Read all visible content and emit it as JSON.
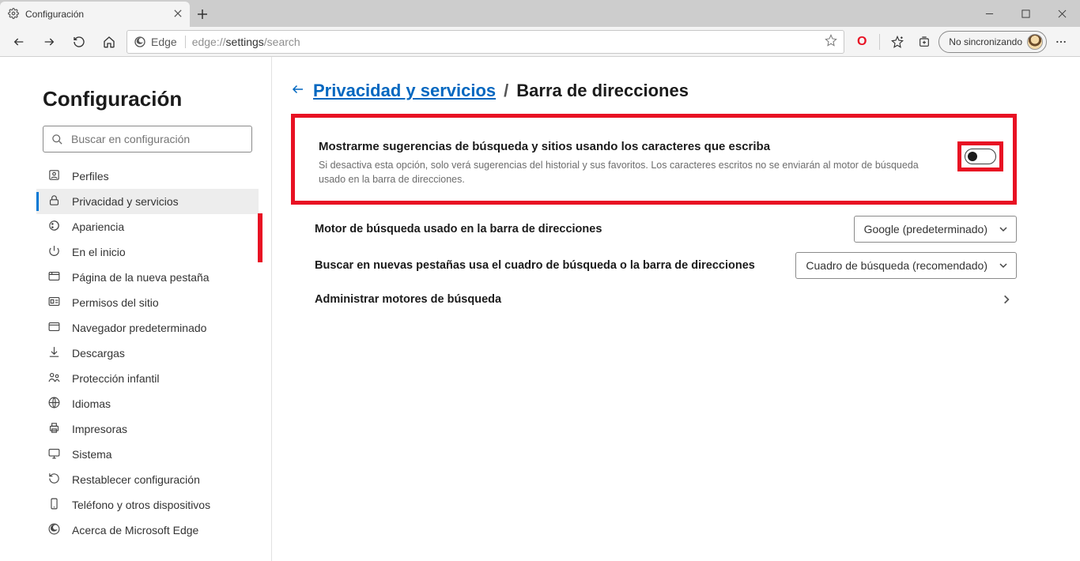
{
  "window": {
    "tab_title": "Configuración",
    "sync_label": "No sincronizando"
  },
  "address": {
    "edge_label": "Edge",
    "url_prefix": "edge://",
    "url_bold": "settings",
    "url_suffix": "/search"
  },
  "sidebar": {
    "title": "Configuración",
    "search_placeholder": "Buscar en configuración",
    "items": [
      {
        "label": "Perfiles",
        "icon": "profile"
      },
      {
        "label": "Privacidad y servicios",
        "icon": "lock",
        "active": true
      },
      {
        "label": "Apariencia",
        "icon": "appearance"
      },
      {
        "label": "En el inicio",
        "icon": "power"
      },
      {
        "label": "Página de la nueva pestaña",
        "icon": "newtab"
      },
      {
        "label": "Permisos del sitio",
        "icon": "permissions"
      },
      {
        "label": "Navegador predeterminado",
        "icon": "default"
      },
      {
        "label": "Descargas",
        "icon": "download"
      },
      {
        "label": "Protección infantil",
        "icon": "family"
      },
      {
        "label": "Idiomas",
        "icon": "globe"
      },
      {
        "label": "Impresoras",
        "icon": "printer"
      },
      {
        "label": "Sistema",
        "icon": "system"
      },
      {
        "label": "Restablecer configuración",
        "icon": "reset"
      },
      {
        "label": "Teléfono y otros dispositivos",
        "icon": "phone"
      },
      {
        "label": "Acerca de Microsoft Edge",
        "icon": "edge"
      }
    ]
  },
  "breadcrumb": {
    "link": "Privacidad y servicios",
    "separator": "/",
    "current": "Barra de direcciones"
  },
  "highlight": {
    "title": "Mostrarme sugerencias de búsqueda y sitios usando los caracteres que escriba",
    "description": "Si desactiva esta opción, solo verá sugerencias del historial y sus favoritos. Los caracteres escritos no se enviarán al motor de búsqueda usado en la barra de direcciones.",
    "toggle_on": false
  },
  "settings": {
    "engine_label": "Motor de búsqueda usado en la barra de direcciones",
    "engine_value": "Google (predeterminado)",
    "newtab_label": "Buscar en nuevas pestañas usa el cuadro de búsqueda o la barra de direcciones",
    "newtab_value": "Cuadro de búsqueda (recomendado)",
    "manage_label": "Administrar motores de búsqueda"
  }
}
